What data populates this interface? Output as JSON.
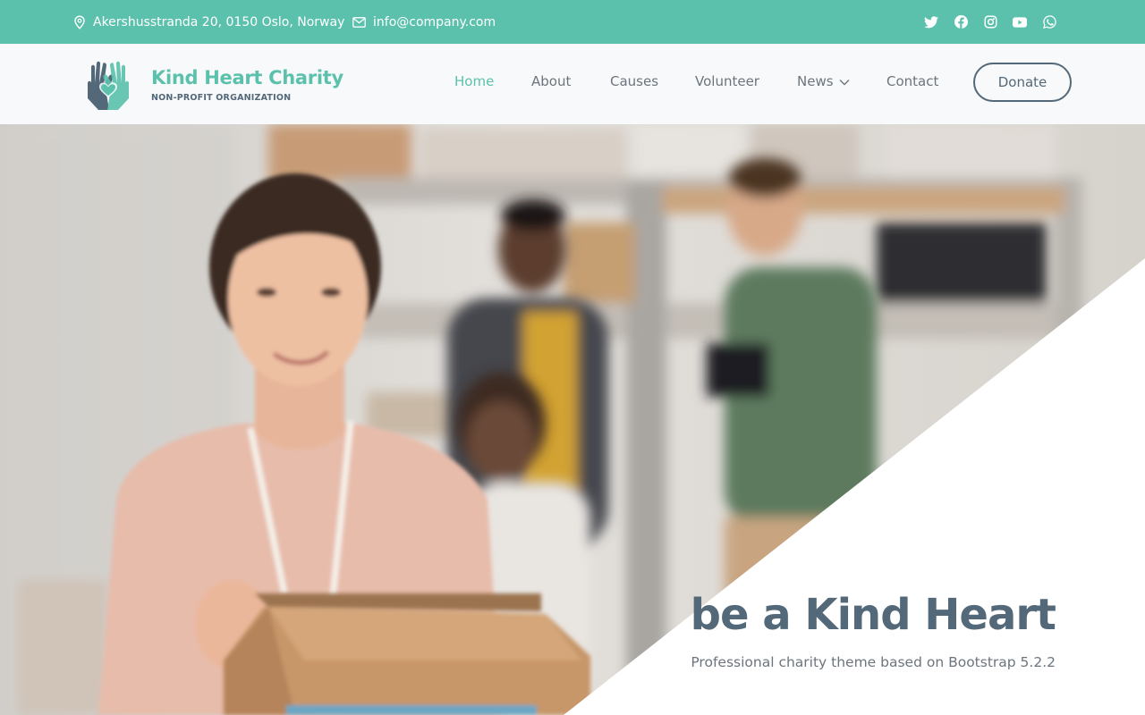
{
  "topbar": {
    "address": "Akershusstranda 20, 0150 Oslo, Norway",
    "email": "info@company.com",
    "background_color": "#5bc1ac",
    "social_icons": [
      "twitter-icon",
      "facebook-icon",
      "instagram-icon",
      "youtube-icon",
      "whatsapp-icon"
    ]
  },
  "brand": {
    "name": "Kind Heart Charity",
    "tagline": "NON-PROFIT ORGANIZATION",
    "logo_icon": "helping-hands-heart-icon",
    "primary_color": "#5bc1ac",
    "secondary_color": "#536878"
  },
  "nav": {
    "items": [
      {
        "label": "Home",
        "active": true
      },
      {
        "label": "About",
        "active": false
      },
      {
        "label": "Causes",
        "active": false
      },
      {
        "label": "Volunteer",
        "active": false
      },
      {
        "label": "News",
        "active": false,
        "has_dropdown": true
      },
      {
        "label": "Contact",
        "active": false
      }
    ],
    "donate_label": "Donate"
  },
  "hero": {
    "title": "be a Kind Heart",
    "subtitle": "Professional charity theme based on Bootstrap 5.2.2",
    "image": "volunteer-woman-holding-cardboard-box-photo"
  }
}
